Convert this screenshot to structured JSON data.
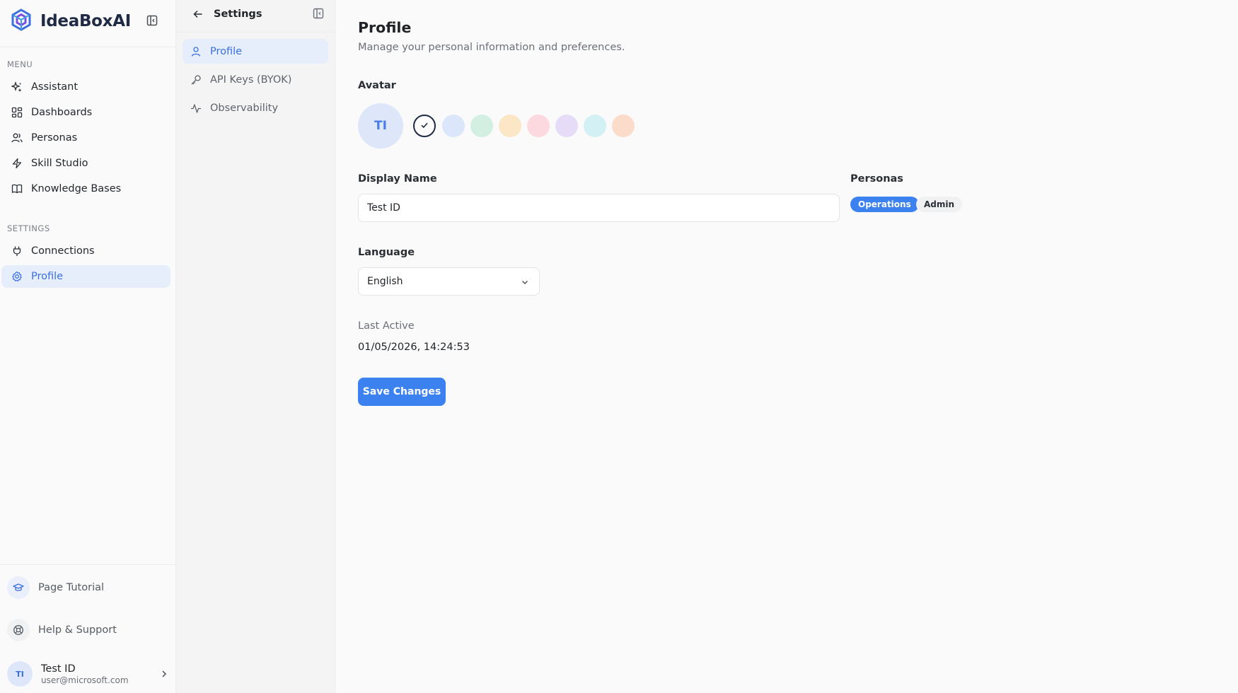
{
  "brand": {
    "name": "IdeaBoxAI",
    "accent": "#3b6fe0"
  },
  "sidebar": {
    "menu_label": "MENU",
    "menu_items": [
      {
        "label": "Assistant",
        "icon": "sparkle-icon"
      },
      {
        "label": "Dashboards",
        "icon": "dashboard-grid-icon"
      },
      {
        "label": "Personas",
        "icon": "users-icon"
      },
      {
        "label": "Skill Studio",
        "icon": "lightning-icon"
      },
      {
        "label": "Knowledge Bases",
        "icon": "book-icon"
      }
    ],
    "settings_label": "SETTINGS",
    "settings_items": [
      {
        "label": "Connections",
        "icon": "plug-icon"
      },
      {
        "label": "Profile",
        "icon": "gear-icon",
        "active": true
      }
    ],
    "utilities": [
      {
        "label": "Page Tutorial",
        "icon": "graduation-cap-icon"
      },
      {
        "label": "Help & Support",
        "icon": "lifebuoy-icon"
      }
    ],
    "user": {
      "initials": "TI",
      "name": "Test ID",
      "email": "user@microsoft.com"
    }
  },
  "settings_panel": {
    "title": "Settings",
    "items": [
      {
        "label": "Profile",
        "icon": "user-icon",
        "active": true
      },
      {
        "label": "API Keys (BYOK)",
        "icon": "key-icon"
      },
      {
        "label": "Observability",
        "icon": "activity-icon"
      }
    ]
  },
  "profile": {
    "title": "Profile",
    "subtitle": "Manage your personal information and preferences.",
    "avatar_label": "Avatar",
    "avatar_initials": "TI",
    "avatar_colors": [
      "#ffffff",
      "#dce6fb",
      "#d3efe2",
      "#fbe7c6",
      "#fbd9df",
      "#e6dcf8",
      "#d3f0f5",
      "#fbdccb"
    ],
    "selected_color_index": 0,
    "display_name_label": "Display Name",
    "display_name_value": "Test ID",
    "personas_label": "Personas",
    "personas": [
      {
        "label": "Operations",
        "selected": true
      },
      {
        "label": "Admin",
        "selected": false
      }
    ],
    "language_label": "Language",
    "language_value": "English",
    "last_active_label": "Last Active",
    "last_active_value": "01/05/2026, 14:24:53",
    "save_label": "Save Changes"
  }
}
